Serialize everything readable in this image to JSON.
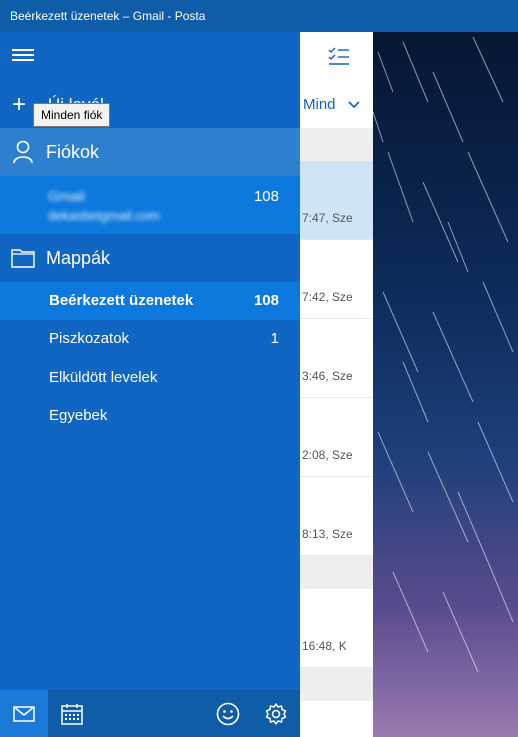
{
  "window": {
    "title": "Beérkezett üzenetek – Gmail - Posta"
  },
  "nav": {
    "new_mail_label": "Új levél",
    "tooltip": "Minden fiók",
    "accounts_header": "Fiókok",
    "account": {
      "name": "Gmail",
      "email": "dekasbetgmail.com",
      "count": "108"
    },
    "folders_header": "Mappák",
    "folders": [
      {
        "label": "Beérkezett üzenetek",
        "count": "108"
      },
      {
        "label": "Piszkozatok",
        "count": "1"
      },
      {
        "label": "Elküldött levelek",
        "count": ""
      },
      {
        "label": "Egyebek",
        "count": ""
      }
    ],
    "bottom_icons": [
      "mail-icon",
      "calendar-icon",
      "smiley-icon",
      "gear-icon"
    ]
  },
  "message_list": {
    "filter_label": "Mind",
    "times": [
      "7:47, Sze",
      "7:42, Sze",
      "3:46, Sze",
      "2:08, Sze",
      "8:13, Sze",
      "16:48, K"
    ]
  },
  "colors": {
    "nav_bg": "#1166c3",
    "selected": "#0d78de",
    "titlebar": "#0f5ca9"
  }
}
